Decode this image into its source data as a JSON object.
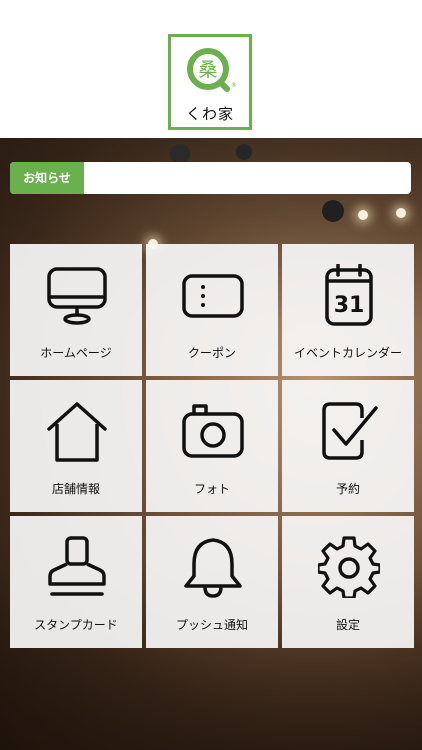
{
  "logo": {
    "glyph": "桑",
    "name": "くわ家",
    "registered": "®",
    "brand_color": "#6ab04c"
  },
  "news": {
    "label": "お知らせ",
    "text": ""
  },
  "menu": [
    {
      "label": "ホームページ",
      "icon": "monitor-icon"
    },
    {
      "label": "クーポン",
      "icon": "coupon-icon"
    },
    {
      "label": "イベントカレンダー",
      "icon": "calendar-icon",
      "icon_text": "31"
    },
    {
      "label": "店舗情報",
      "icon": "house-icon"
    },
    {
      "label": "フォト",
      "icon": "camera-icon"
    },
    {
      "label": "予約",
      "icon": "checkbox-icon"
    },
    {
      "label": "スタンプカード",
      "icon": "stamp-icon"
    },
    {
      "label": "プッシュ通知",
      "icon": "bell-icon"
    },
    {
      "label": "設定",
      "icon": "gear-icon"
    }
  ]
}
